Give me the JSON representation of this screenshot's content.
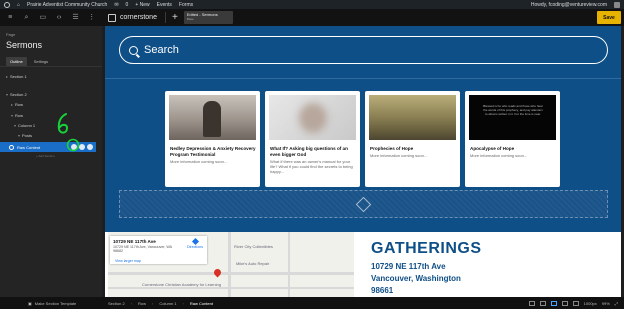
{
  "wp_admin_bar": {
    "site_name": "Prairie Adventist Community Church",
    "comments_count": "0",
    "new_label": "+ New",
    "events_label": "Events",
    "forms_label": "Forms",
    "howdy": "Howdy, fcoding@ventureview.com"
  },
  "topbar": {
    "brand": "cornerstone",
    "plus": "+",
    "tab_title": "Edited - Sermons",
    "tab_sub": "Base",
    "save_label": "Save"
  },
  "left_panel": {
    "subtitle": "Page",
    "title": "Sermons",
    "tabs": [
      {
        "label": "Outline"
      },
      {
        "label": "Settings"
      }
    ],
    "tree": {
      "section1": "Section 1",
      "section2": "Section 2",
      "row1": "Row",
      "row2": "Row",
      "column1": "Column 1",
      "posts": "Posts",
      "selected": "Raw Content",
      "add_section": "+ Add Section"
    }
  },
  "canvas": {
    "search_placeholder": "Search",
    "cards": [
      {
        "title": "Nedley Depression & Anxiety Recovery Program Testimonial",
        "excerpt": "More information coming soon..."
      },
      {
        "title": "What If? Asking big questions of an even bigger God",
        "excerpt": "What if there was an owner's manual for your life? What if you could find the secrets to being happy..."
      },
      {
        "title": "Prophecies of Hope",
        "excerpt": "More information coming soon..."
      },
      {
        "title": "Apocalypse of Hope",
        "excerpt": "More information coming soon..."
      }
    ],
    "card4_thumb_text": "Blessed is he who reads and those who hear the words of this prophecy, and pay attention to what is written in it. For the time is near.",
    "map": {
      "title": "10729 NE 117th Ave",
      "address": "10729 NE 117th Ave, Vancouver, WA 98682",
      "directions": "Directions",
      "larger_map": "View larger map",
      "labels": [
        "River City Collectibles",
        "Mike's Auto Repair",
        "Cornerstone Christian Academy for Learning"
      ]
    },
    "gatherings": {
      "title": "GATHERINGS",
      "line1": "10729 NE 117th Ave",
      "line2": "Vancouver, Washington",
      "line3": "98661"
    }
  },
  "bottombar": {
    "template_label": "Make Section Template",
    "crumbs": [
      {
        "label": "Section 2"
      },
      {
        "label": "Row"
      },
      {
        "label": "Column 1"
      },
      {
        "label": "Raw Content"
      }
    ],
    "zoom": "1000px",
    "zoom_pct": "99%"
  },
  "colors": {
    "accent_blue": "#0f4f87",
    "save_yellow": "#e6b400",
    "selection_blue": "#1a6ec7",
    "annotation_green": "#18d13a"
  }
}
